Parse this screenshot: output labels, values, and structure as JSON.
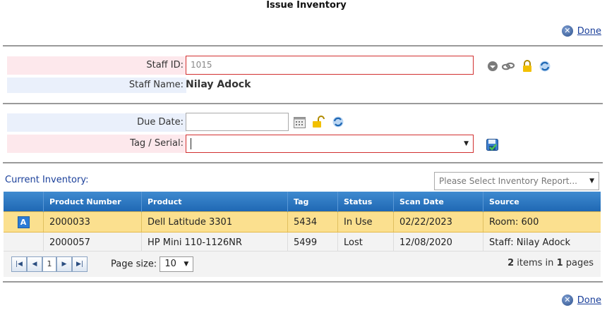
{
  "header": {
    "title": "Issue Inventory",
    "done_label": "Done"
  },
  "staff": {
    "id_label": "Staff ID:",
    "id_value": "1015",
    "name_label": "Staff Name:",
    "name_value": "Nilay Adock"
  },
  "issue": {
    "due_label": "Due Date:",
    "due_value": "",
    "tag_label": "Tag / Serial:",
    "tag_value": ""
  },
  "inventory": {
    "label": "Current Inventory:",
    "report_placeholder": "Please Select Inventory Report...",
    "columns": [
      "Product Number",
      "Product",
      "Tag",
      "Status",
      "Scan Date",
      "Source"
    ],
    "rows": [
      {
        "badge": "A",
        "product_number": "2000033",
        "product": "Dell Latitude 3301",
        "tag": "5434",
        "status": "In Use",
        "scan_date": "02/22/2023",
        "source": "Room: 600"
      },
      {
        "badge": "",
        "product_number": "2000057",
        "product": "HP Mini 110-1126NR",
        "tag": "5499",
        "status": "Lost",
        "scan_date": "12/08/2020",
        "source": "Staff: Nilay Adock"
      }
    ],
    "pager": {
      "current_page": "1",
      "page_size_label": "Page size:",
      "page_size": "10",
      "items_count": "2",
      "items_text": "items in",
      "pages_count": "1",
      "pages_text": "pages"
    }
  },
  "colors": {
    "accent": "#1f68b4",
    "selected_row": "#fbe08f",
    "required_border": "#d23030"
  }
}
